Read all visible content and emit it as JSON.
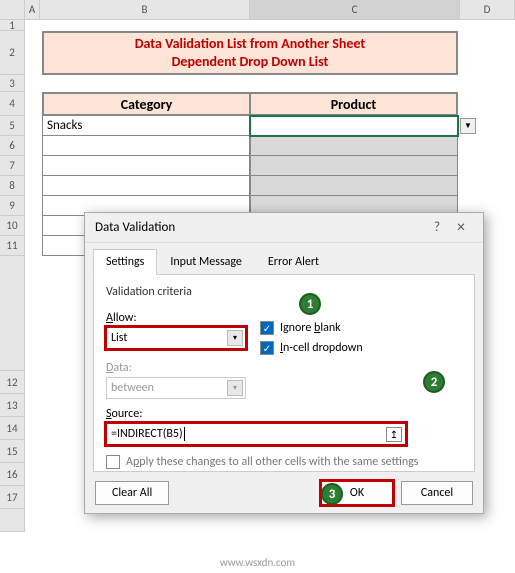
{
  "columns": {
    "a": "A",
    "b": "B",
    "c": "C",
    "d": "D"
  },
  "rows": [
    "1",
    "2",
    "3",
    "4",
    "5",
    "6",
    "7",
    "8",
    "9",
    "10",
    "11",
    "12",
    "13",
    "14",
    "15",
    "16",
    "17"
  ],
  "title_line1": "Data Validation List from Another Sheet",
  "title_line2": "Dependent Drop Down List",
  "table": {
    "header1": "Category",
    "header2": "Product",
    "row1_col1": "Snacks"
  },
  "dialog": {
    "title": "Data Validation",
    "help": "?",
    "close": "×",
    "tabs": {
      "settings": "Settings",
      "input": "Input Message",
      "error": "Error Alert"
    },
    "section": "Validation criteria",
    "allow_label": "Allow:",
    "allow_value": "List",
    "data_label": "Data:",
    "data_value": "between",
    "chk_ignore": "Ignore blank",
    "chk_incell": "In-cell dropdown",
    "source_label": "Source:",
    "source_value": "=INDIRECT(B5)",
    "apply_text": "Apply these changes to all other cells with the same settings",
    "clear": "Clear All",
    "ok": "OK",
    "cancel": "Cancel"
  },
  "callouts": {
    "n1": "1",
    "n2": "2",
    "n3": "3"
  },
  "watermark": "www.wsxdn.com",
  "chart_data": null
}
